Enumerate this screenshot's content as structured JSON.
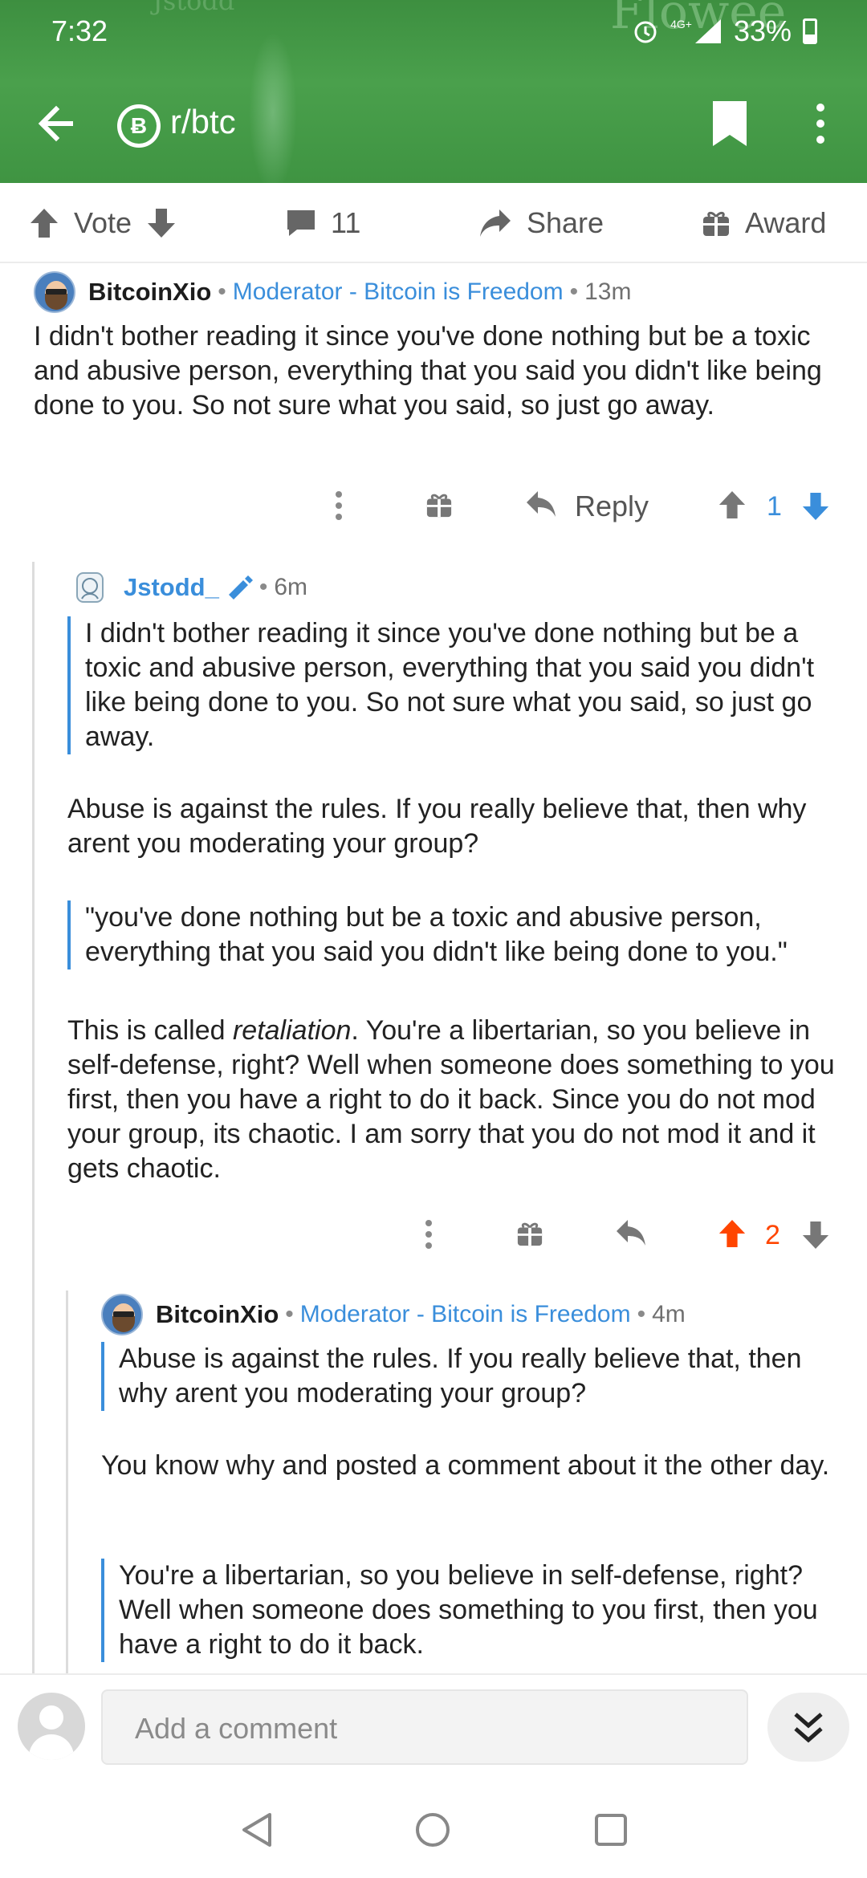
{
  "status": {
    "time": "7:32",
    "network": "4G+",
    "battery": "33%"
  },
  "toolbar": {
    "subreddit": "r/btc",
    "icon_letter": "Ƀ"
  },
  "action_bar": {
    "vote": "Vote",
    "comments": "11",
    "share": "Share",
    "award": "Award"
  },
  "comments": [
    {
      "author": "BitcoinXio",
      "flair": "Moderator - Bitcoin is Freedom",
      "time": "13m",
      "body": "I didn't bother reading it since you've done nothing but be a toxic and abusive person, everything that you said you didn't like being done to you. So not sure what you said, so just go away.",
      "reply_label": "Reply",
      "score": "1"
    },
    {
      "author": "Jstodd_",
      "time": "6m",
      "quote1": "I didn't bother reading it since you've done nothing but be a toxic and abusive person, everything that you said you didn't like being done to you. So not sure what you said, so just go away.",
      "para1": "Abuse is against the rules. If you really believe that, then why arent you moderating your group?",
      "quote2": "\"you've done nothing but be a toxic and abusive person, everything that you said you didn't like being done to you.\"",
      "para2_pre": "This is called ",
      "para2_em": "retaliation",
      "para2_post": ". You're a libertarian, so you believe in self-defense, right? Well when someone does something to you first, then you have a right to do it back. Since you do not mod your group, its chaotic. I am sorry that you do not mod it and it gets chaotic.",
      "score": "2"
    },
    {
      "author": "BitcoinXio",
      "flair": "Moderator - Bitcoin is Freedom",
      "time": "4m",
      "quote1": "Abuse is against the rules. If you really believe that, then why arent you moderating your group?",
      "para1": "You know why and posted a comment about it the other day.",
      "quote2": "You're a libertarian, so you believe in self-defense, right? Well when someone does something to you first, then you have a right to do it back."
    }
  ],
  "composer": {
    "placeholder": "Add a comment"
  },
  "colors": {
    "header": "#46a049",
    "link": "#3a8edb",
    "upvote": "#ff4500",
    "downvote": "#3a8edb"
  }
}
